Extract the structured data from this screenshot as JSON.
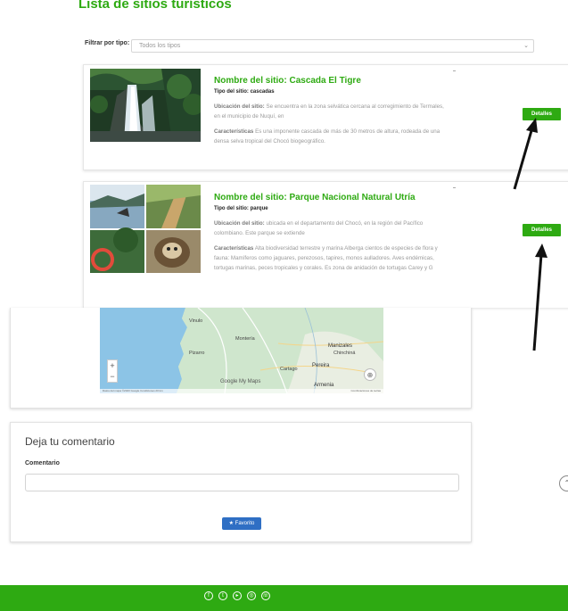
{
  "page": {
    "title": "Lista de sitios turísticos"
  },
  "filter": {
    "label": "Filtrar por tipo:",
    "value": "Todos los tipos"
  },
  "sites": [
    {
      "name_prefix": "Nombre del sitio:",
      "name": "Cascada El Tigre",
      "type_prefix": "Tipo del sitio:",
      "type": "cascadas",
      "location_label": "Ubicación del sitio:",
      "location": "Se encuentra en la zona selvática cercana al corregimiento de Termales, en el municipio de Nuquí, en",
      "features_label": "Características",
      "features": "Es una imponente cascada de más de 30 metros de altura, rodeada de una densa selva tropical del Chocó biogeográfico.",
      "button": "Detalles"
    },
    {
      "name_prefix": "Nombre del sitio:",
      "name": "Parque Nacional Natural Utría",
      "type_prefix": "Tipo del sitio:",
      "type": "parque",
      "location_label": "Ubicación del sitio:",
      "location": "ubicada en el departamento del Chocó, en la región del Pacífico colombiano. Este parque se extiende",
      "features_label": "Características",
      "features": "Alta biodiversidad terrestre y marina Alberga cientos de especies de flora y fauna: Mamíferos como jaguares, perezosos, tapires, monos aulladores. Aves endémicas, tortugas marinas, peces tropicales y corales. Es zona de anidación de tortugas Carey y G",
      "button": "Detalles"
    }
  ],
  "map": {
    "cities": [
      "Vinulo",
      "Montería",
      "Pizarro",
      "Manizales",
      "Pereira",
      "Armenia",
      "Cartago",
      "Chinchiná"
    ],
    "brand": "Google My Maps",
    "attribution_left": "Datos del mapa ©2023 Google   Condiciones   20 km",
    "attribution_right": "Combinaciones de teclas",
    "zoom_in": "+",
    "zoom_out": "−"
  },
  "comment": {
    "title": "Deja tu comentario",
    "label": "Comentario",
    "button": "★ Favorito"
  },
  "footer": {
    "social_icons": [
      "facebook-icon",
      "twitter-icon",
      "youtube-icon",
      "instagram-icon",
      "whatsapp-icon"
    ]
  },
  "colors": {
    "accent": "#2eaa12",
    "button_blue": "#2f6fc4"
  }
}
